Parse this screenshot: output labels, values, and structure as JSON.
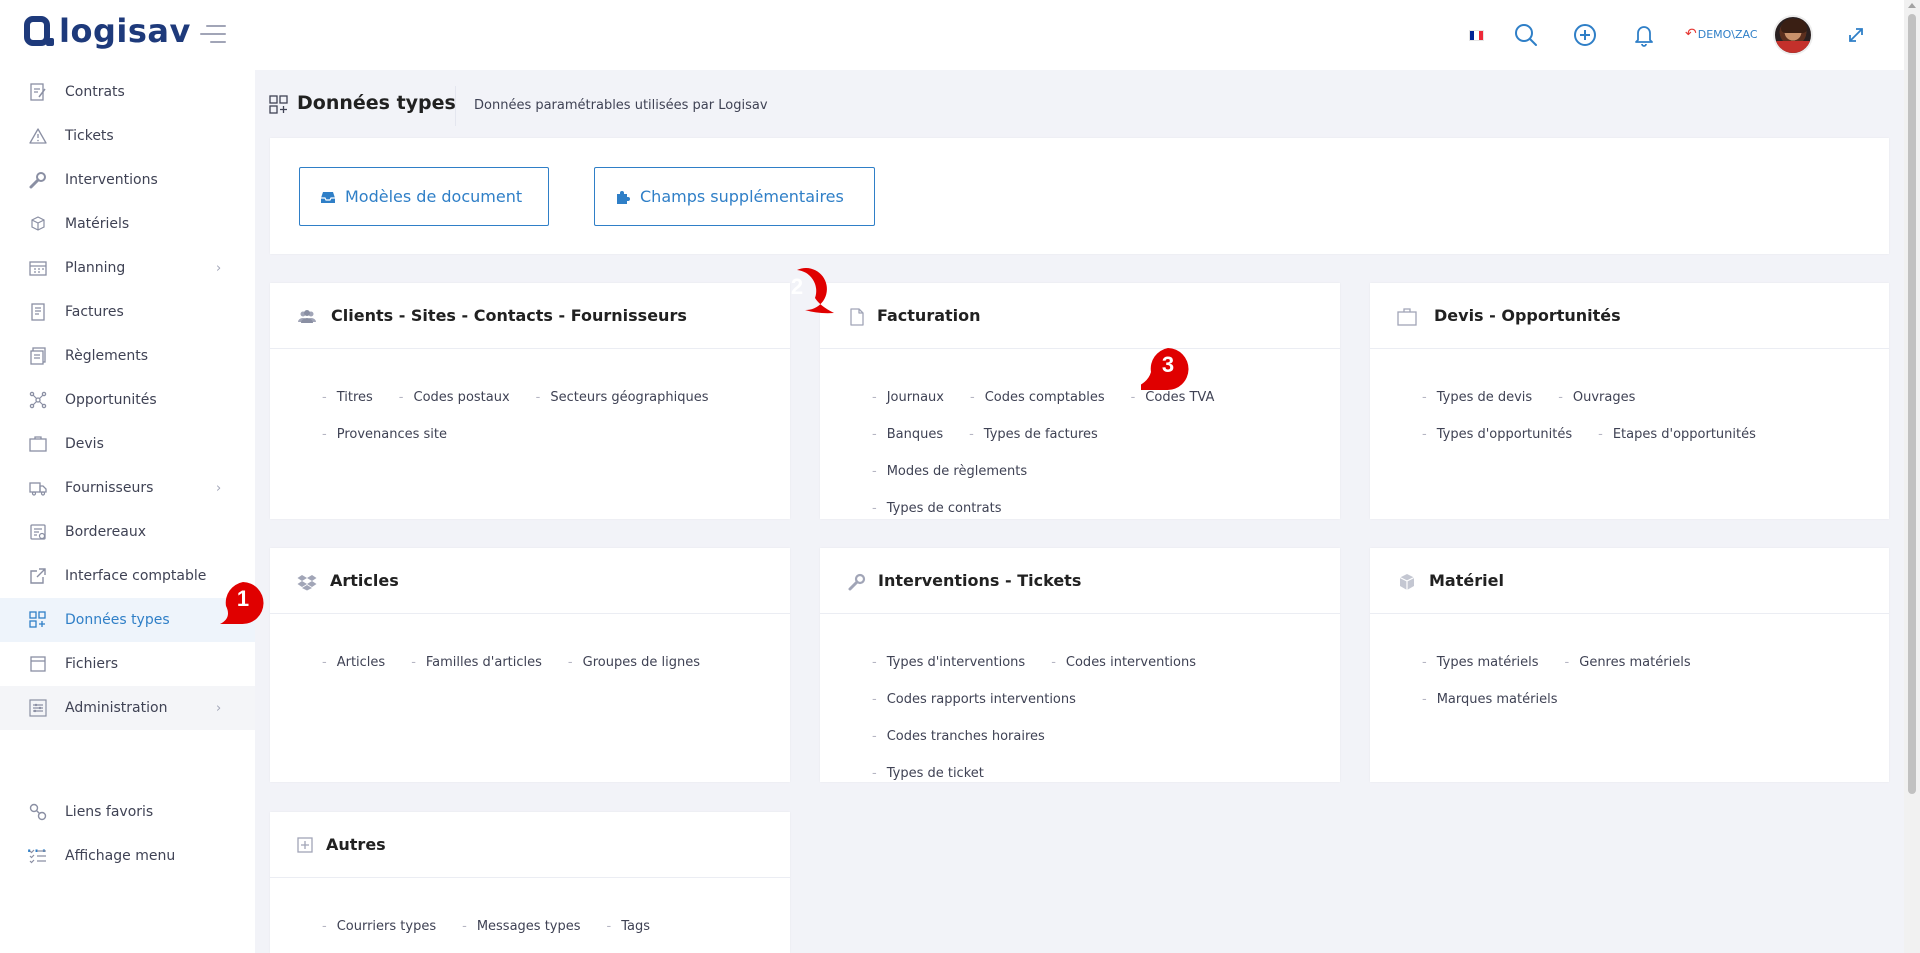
{
  "app": {
    "logo_text": "logisav"
  },
  "header": {
    "user": "DEMO\\ZAC",
    "flag_colors": [
      "#002395",
      "#ffffff",
      "#ed2939"
    ],
    "icons": [
      "search-icon",
      "plus-circle-icon",
      "bell-icon",
      "undo-icon",
      "expand-icon"
    ]
  },
  "sidebar": {
    "items": [
      {
        "label": "Contrats",
        "icon": "contract-icon"
      },
      {
        "label": "Tickets",
        "icon": "warning-icon"
      },
      {
        "label": "Interventions",
        "icon": "wrench-icon"
      },
      {
        "label": "Matériels",
        "icon": "cube-icon"
      },
      {
        "label": "Planning",
        "icon": "calendar-icon",
        "has_children": true
      },
      {
        "label": "Factures",
        "icon": "invoice-icon"
      },
      {
        "label": "Règlements",
        "icon": "payment-icon"
      },
      {
        "label": "Opportunités",
        "icon": "network-icon"
      },
      {
        "label": "Devis",
        "icon": "quote-icon"
      },
      {
        "label": "Fournisseurs",
        "icon": "truck-icon",
        "has_children": true
      },
      {
        "label": "Bordereaux",
        "icon": "slip-icon"
      },
      {
        "label": "Interface comptable",
        "icon": "external-link-icon"
      },
      {
        "label": "Données types",
        "icon": "grid-add-icon",
        "active": true
      },
      {
        "label": "Fichiers",
        "icon": "file-icon"
      },
      {
        "label": "Administration",
        "icon": "sliders-icon",
        "has_children": true
      }
    ],
    "more": "...",
    "bottom": [
      {
        "label": "Liens favoris",
        "icon": "link-icon"
      },
      {
        "label": "Affichage menu",
        "icon": "list-check-icon"
      }
    ]
  },
  "page": {
    "title": "Données types",
    "description": "Données paramétrables utilisées par Logisav"
  },
  "actions": {
    "models_label": "Modèles de document",
    "fields_label": "Champs supplémentaires"
  },
  "sections": {
    "clients": {
      "title": "Clients - Sites - Contacts - Fournisseurs",
      "links": [
        "Titres",
        "Codes postaux",
        "Secteurs géographiques",
        "Provenances site"
      ]
    },
    "facturation": {
      "title": "Facturation",
      "links": [
        "Journaux",
        "Codes comptables",
        "Codes TVA",
        "Banques",
        "Types de factures",
        "Modes de règlements",
        "Types de contrats"
      ]
    },
    "devis": {
      "title": "Devis - Opportunités",
      "links": [
        "Types de devis",
        "Ouvrages",
        "Types d'opportunités",
        "Etapes d'opportunités"
      ]
    },
    "articles": {
      "title": "Articles",
      "links": [
        "Articles",
        "Familles d'articles",
        "Groupes de lignes"
      ]
    },
    "interventions": {
      "title": "Interventions - Tickets",
      "links": [
        "Types d'interventions",
        "Codes interventions",
        "Codes rapports interventions",
        "Codes tranches horaires",
        "Types de ticket"
      ]
    },
    "materiel": {
      "title": "Matériel",
      "links": [
        "Types matériels",
        "Genres matériels",
        "Marques matériels"
      ]
    },
    "autres": {
      "title": "Autres",
      "links": [
        "Courriers types",
        "Messages types",
        "Tags"
      ]
    }
  },
  "markers": {
    "m1": "1",
    "m2": "2",
    "m3": "3",
    "color": "#e00000"
  }
}
